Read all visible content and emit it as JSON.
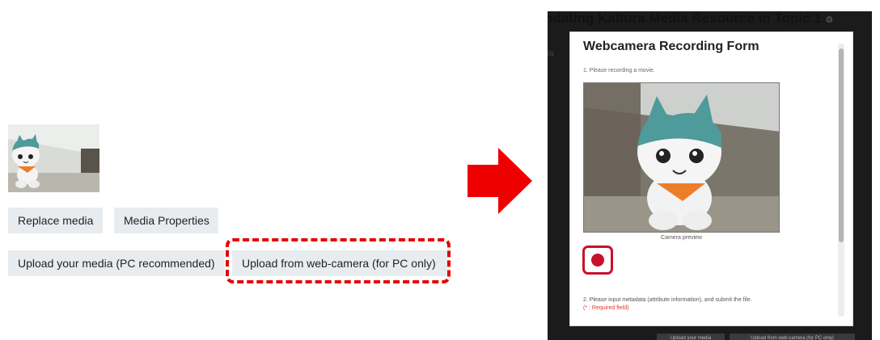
{
  "left_panel": {
    "replace_media_label": "Replace media",
    "media_properties_label": "Media Properties",
    "upload_media_label": "Upload your media (PC recommended)",
    "upload_webcam_label": "Upload from web-camera (for PC only)"
  },
  "right_screenshot": {
    "page_heading": "odating Kaltura Media Resource in Topic 1",
    "side_label": "ia",
    "modal": {
      "title": "Webcamera Recording Form",
      "step1": "1. Please recording a movie.",
      "preview_caption": "Camera preview",
      "step2": "2. Please input metadata (attribute information), and submit the file.",
      "required_note": "(* : Required field)"
    },
    "bottom_left_button": "Upload your media",
    "bottom_right_button": "Upload from web-camera (for PC only)"
  },
  "colors": {
    "highlight": "#e60000",
    "arrow": "#ee0000",
    "record": "#c8102e",
    "button_bg": "#e9ecef"
  }
}
